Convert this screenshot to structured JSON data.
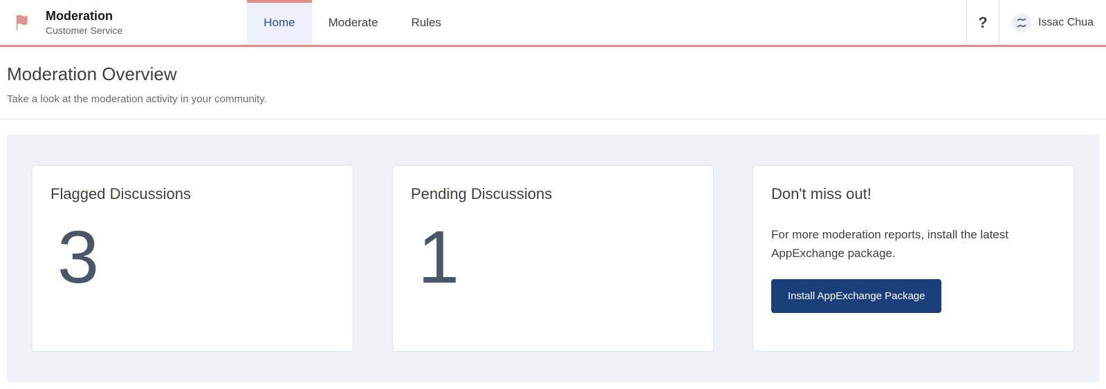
{
  "app": {
    "title": "Moderation",
    "subtitle": "Customer Service"
  },
  "nav": {
    "tabs": [
      {
        "label": "Home",
        "active": true
      },
      {
        "label": "Moderate",
        "active": false
      },
      {
        "label": "Rules",
        "active": false
      }
    ]
  },
  "header": {
    "help_label": "?",
    "user_name": "Issac Chua"
  },
  "page": {
    "title": "Moderation Overview",
    "description": "Take a look at the moderation activity in your community."
  },
  "cards": {
    "flagged": {
      "title": "Flagged Discussions",
      "count": "3"
    },
    "pending": {
      "title": "Pending Discussions",
      "count": "1"
    },
    "promo": {
      "title": "Don't miss out!",
      "text": "For more moderation reports, install the latest AppExchange package.",
      "button": "Install AppExchange Package"
    }
  }
}
